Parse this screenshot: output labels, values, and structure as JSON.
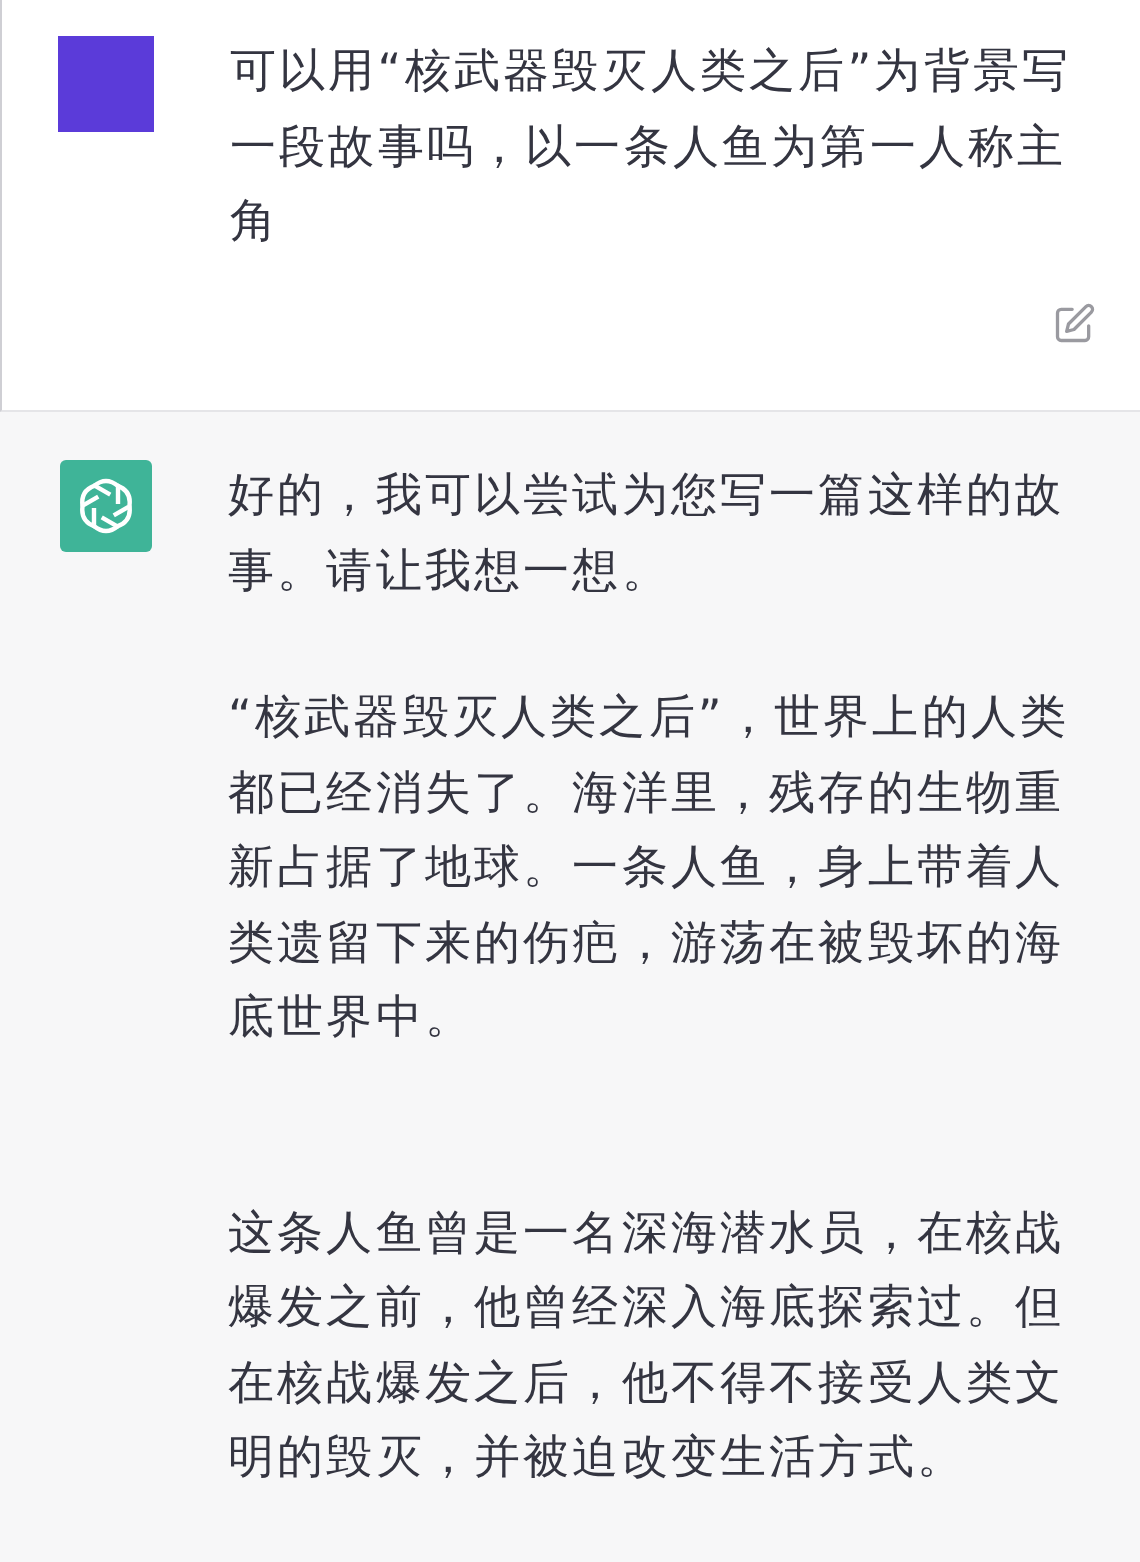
{
  "messages": [
    {
      "kind": "user",
      "paragraphs": [
        "可以用“核武器毁灭人类之后”为背景写一段故事吗，以一条人鱼为第一人称主角"
      ]
    },
    {
      "kind": "assistant",
      "paragraphs": [
        "好的，我可以尝试为您写一篇这样的故事。请让我想一想。",
        "“核武器毁灭人类之后”，世界上的人类都已经消失了。海洋里，残存的生物重新占据了地球。一条人鱼，身上带着人类遗留下来的伤疤，游荡在被毁坏的海底世界中。",
        "这条人鱼曾是一名深海潜水员，在核战爆发之前，他曾经深入海底探索过。但在核战爆发之后，他不得不接受人类文明的毁灭，并被迫改变生活方式。"
      ]
    }
  ]
}
